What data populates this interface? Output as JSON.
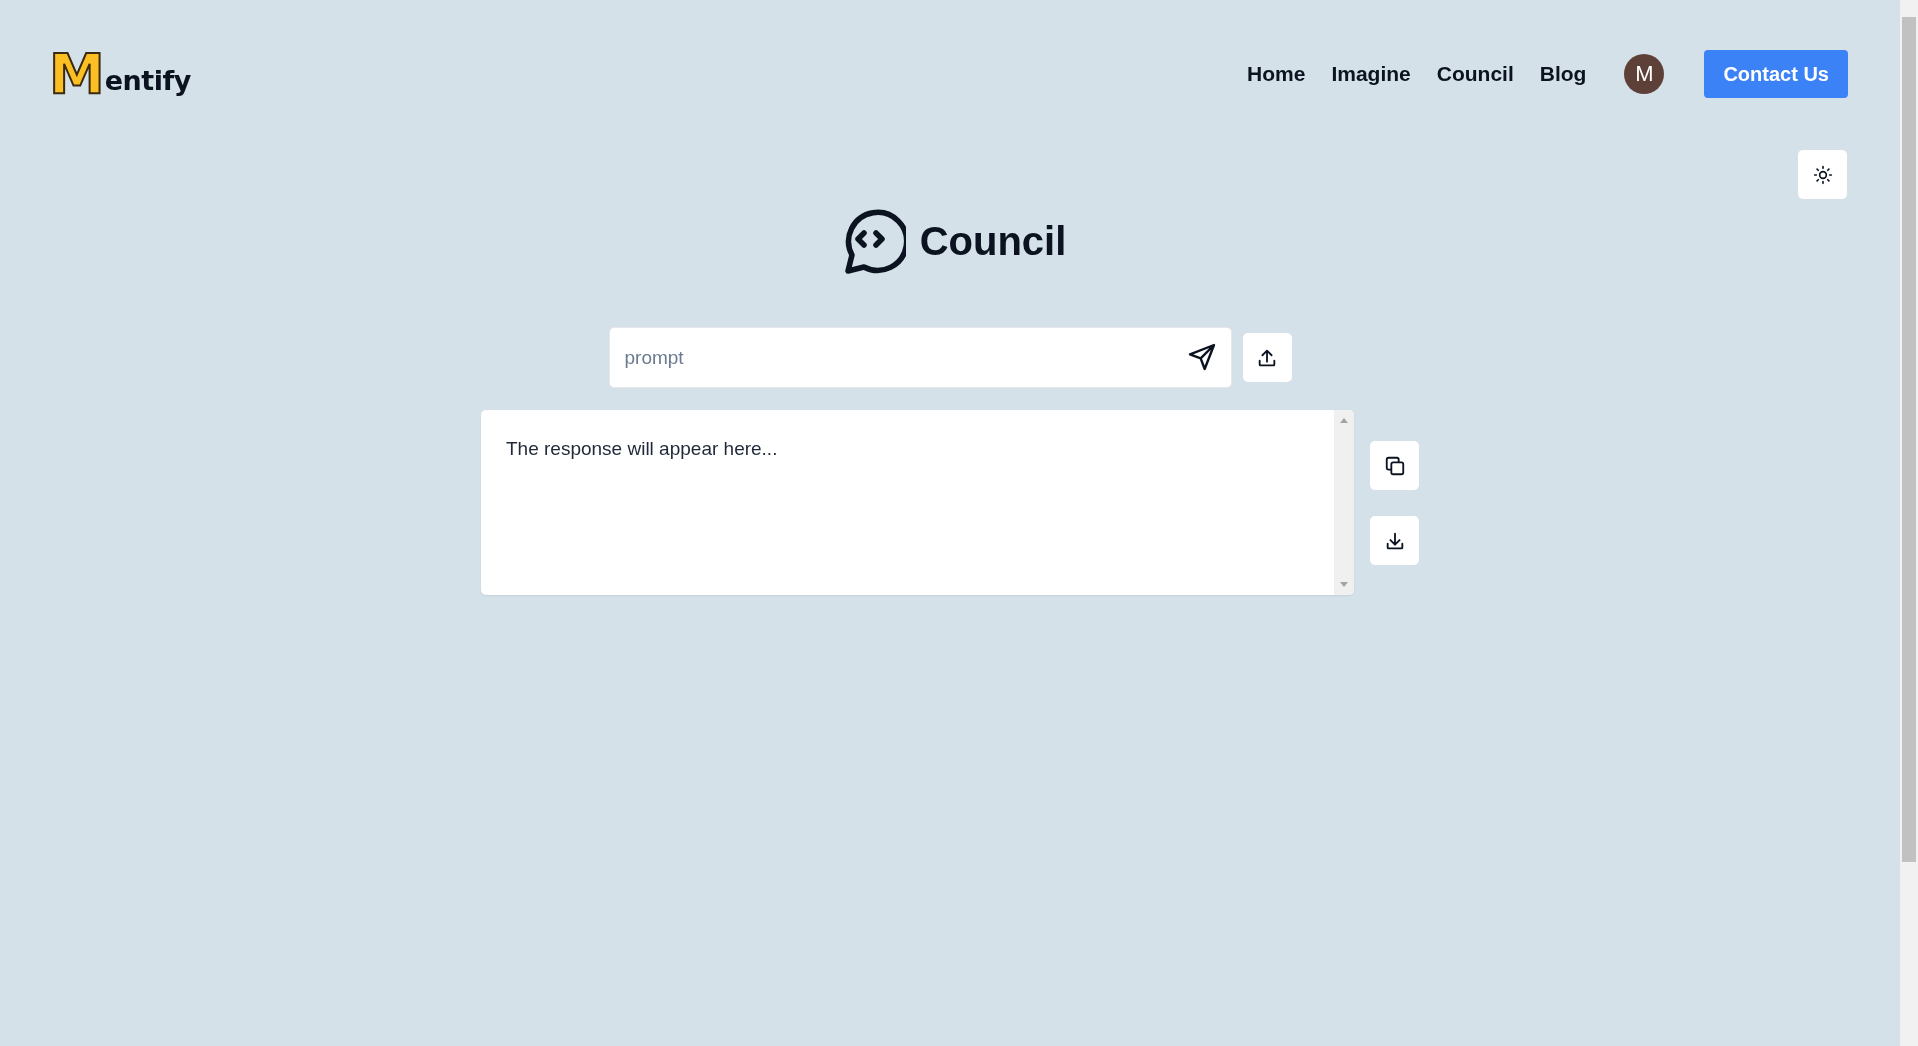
{
  "logo": {
    "initial": "M",
    "text": "entify"
  },
  "nav": {
    "links": [
      {
        "label": "Home"
      },
      {
        "label": "Imagine"
      },
      {
        "label": "Council"
      },
      {
        "label": "Blog"
      }
    ],
    "avatar": "M",
    "contact_button": "Contact Us"
  },
  "page": {
    "title": "Council"
  },
  "prompt": {
    "placeholder": "prompt"
  },
  "response": {
    "text": "The response will appear here..."
  }
}
